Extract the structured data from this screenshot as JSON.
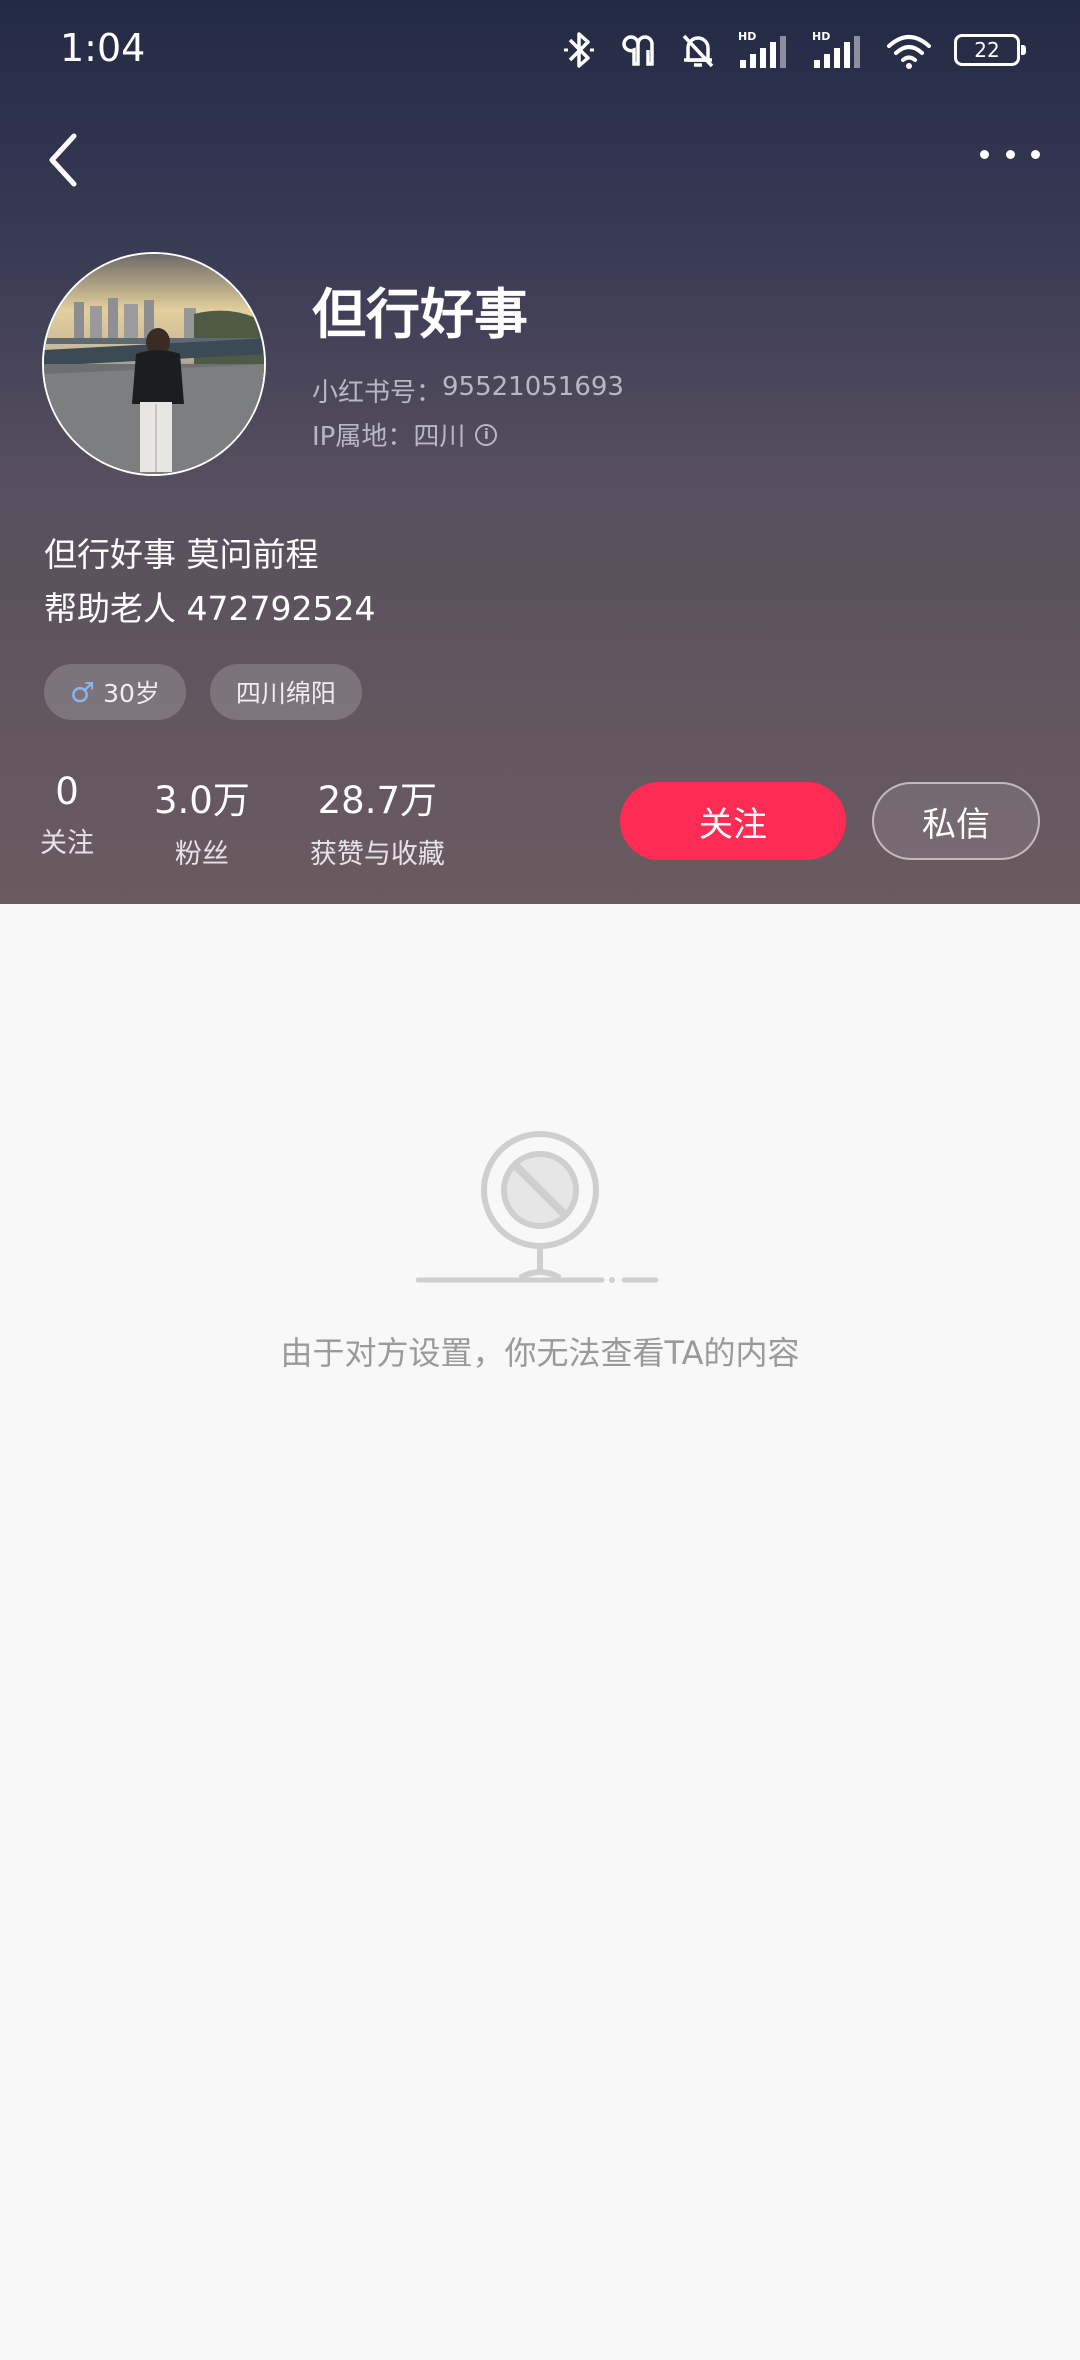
{
  "status_bar": {
    "time": "1:04",
    "battery": "22",
    "icons": [
      "bluetooth-icon",
      "earbuds-icon",
      "bell-off-icon",
      "signal-hd-icon",
      "signal-hd-icon",
      "wifi-icon",
      "battery-icon"
    ]
  },
  "nav": {
    "back_icon": "chevron-left-icon",
    "more_icon": "more-dots-icon"
  },
  "profile": {
    "name": "但行好事",
    "red_id_label": "小红书号：",
    "red_id": "95521051693",
    "ip_label": "IP属地：",
    "ip_location": "四川",
    "bio_line1": "但行好事 莫问前程",
    "bio_line2": "帮助老人 472792524",
    "tags": {
      "age": "30岁",
      "location": "四川绵阳"
    }
  },
  "stats": {
    "following": {
      "value": "0",
      "label": "关注"
    },
    "followers": {
      "value": "3.0万",
      "label": "粉丝"
    },
    "likes": {
      "value": "28.7万",
      "label": "获赞与收藏"
    }
  },
  "actions": {
    "follow": "关注",
    "message": "私信"
  },
  "empty": {
    "message": "由于对方设置，你无法查看TA的内容"
  },
  "colors": {
    "accent": "#fe2c55",
    "header_top": "#232a44",
    "header_bottom": "#6b5b60",
    "background": "#f8f8f8"
  }
}
